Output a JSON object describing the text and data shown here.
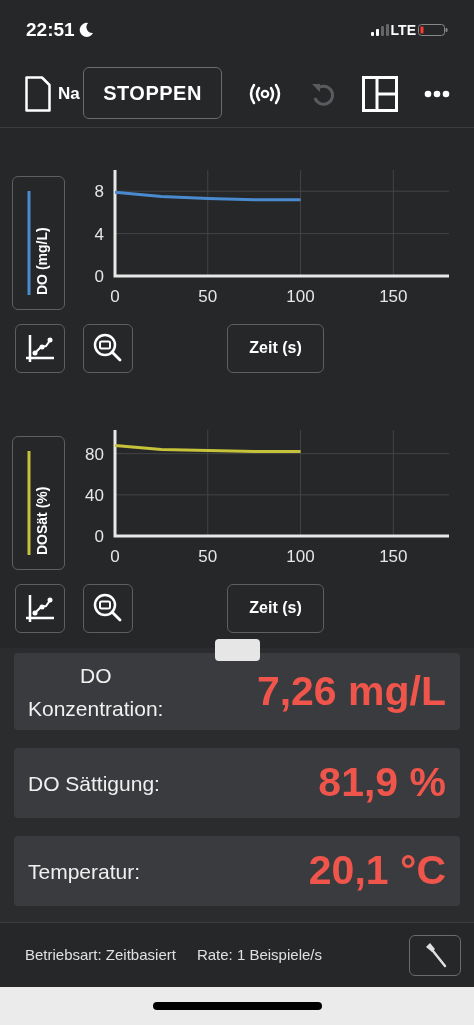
{
  "status_bar": {
    "time": "22:51",
    "network": "LTE"
  },
  "toolbar": {
    "file_name": "Na",
    "stop_button": "STOPPEN",
    "undo_disabled": true
  },
  "graphs": [
    {
      "chart_data": {
        "type": "line",
        "xlabel": "Zeit (s)",
        "ylabel": "DO (mg/L)",
        "grid": true,
        "x": [
          0,
          25,
          50,
          75,
          100
        ],
        "xlim": [
          0,
          180
        ],
        "ylim": [
          0,
          10
        ],
        "xticks": [
          0,
          50,
          100,
          150
        ],
        "yticks": [
          0,
          4,
          8
        ],
        "series": [
          {
            "color": "#4a8bd0",
            "values": [
              7.9,
              7.5,
              7.3,
              7.2,
              7.2
            ]
          }
        ]
      }
    },
    {
      "chart_data": {
        "type": "line",
        "xlabel": "Zeit (s)",
        "ylabel": "DOSät (%)",
        "grid": true,
        "x": [
          0,
          25,
          50,
          75,
          100
        ],
        "xlim": [
          0,
          180
        ],
        "ylim": [
          0,
          103
        ],
        "xticks": [
          0,
          50,
          100,
          150
        ],
        "yticks": [
          0,
          40,
          80
        ],
        "series": [
          {
            "color": "#c6c23a",
            "values": [
              88,
              84,
              83,
              82,
              82
            ]
          }
        ]
      }
    }
  ],
  "readouts": [
    {
      "label": "DO\nKonzentration:",
      "value": "7,26 mg/L"
    },
    {
      "label": "DO Sättigung:",
      "value": "81,9 %"
    },
    {
      "label": "Temperatur:",
      "value": "20,1 °C"
    }
  ],
  "footer": {
    "mode": "Betriebsart: Zeitbasiert",
    "rate": "Rate: 1 Beispiele/s"
  }
}
